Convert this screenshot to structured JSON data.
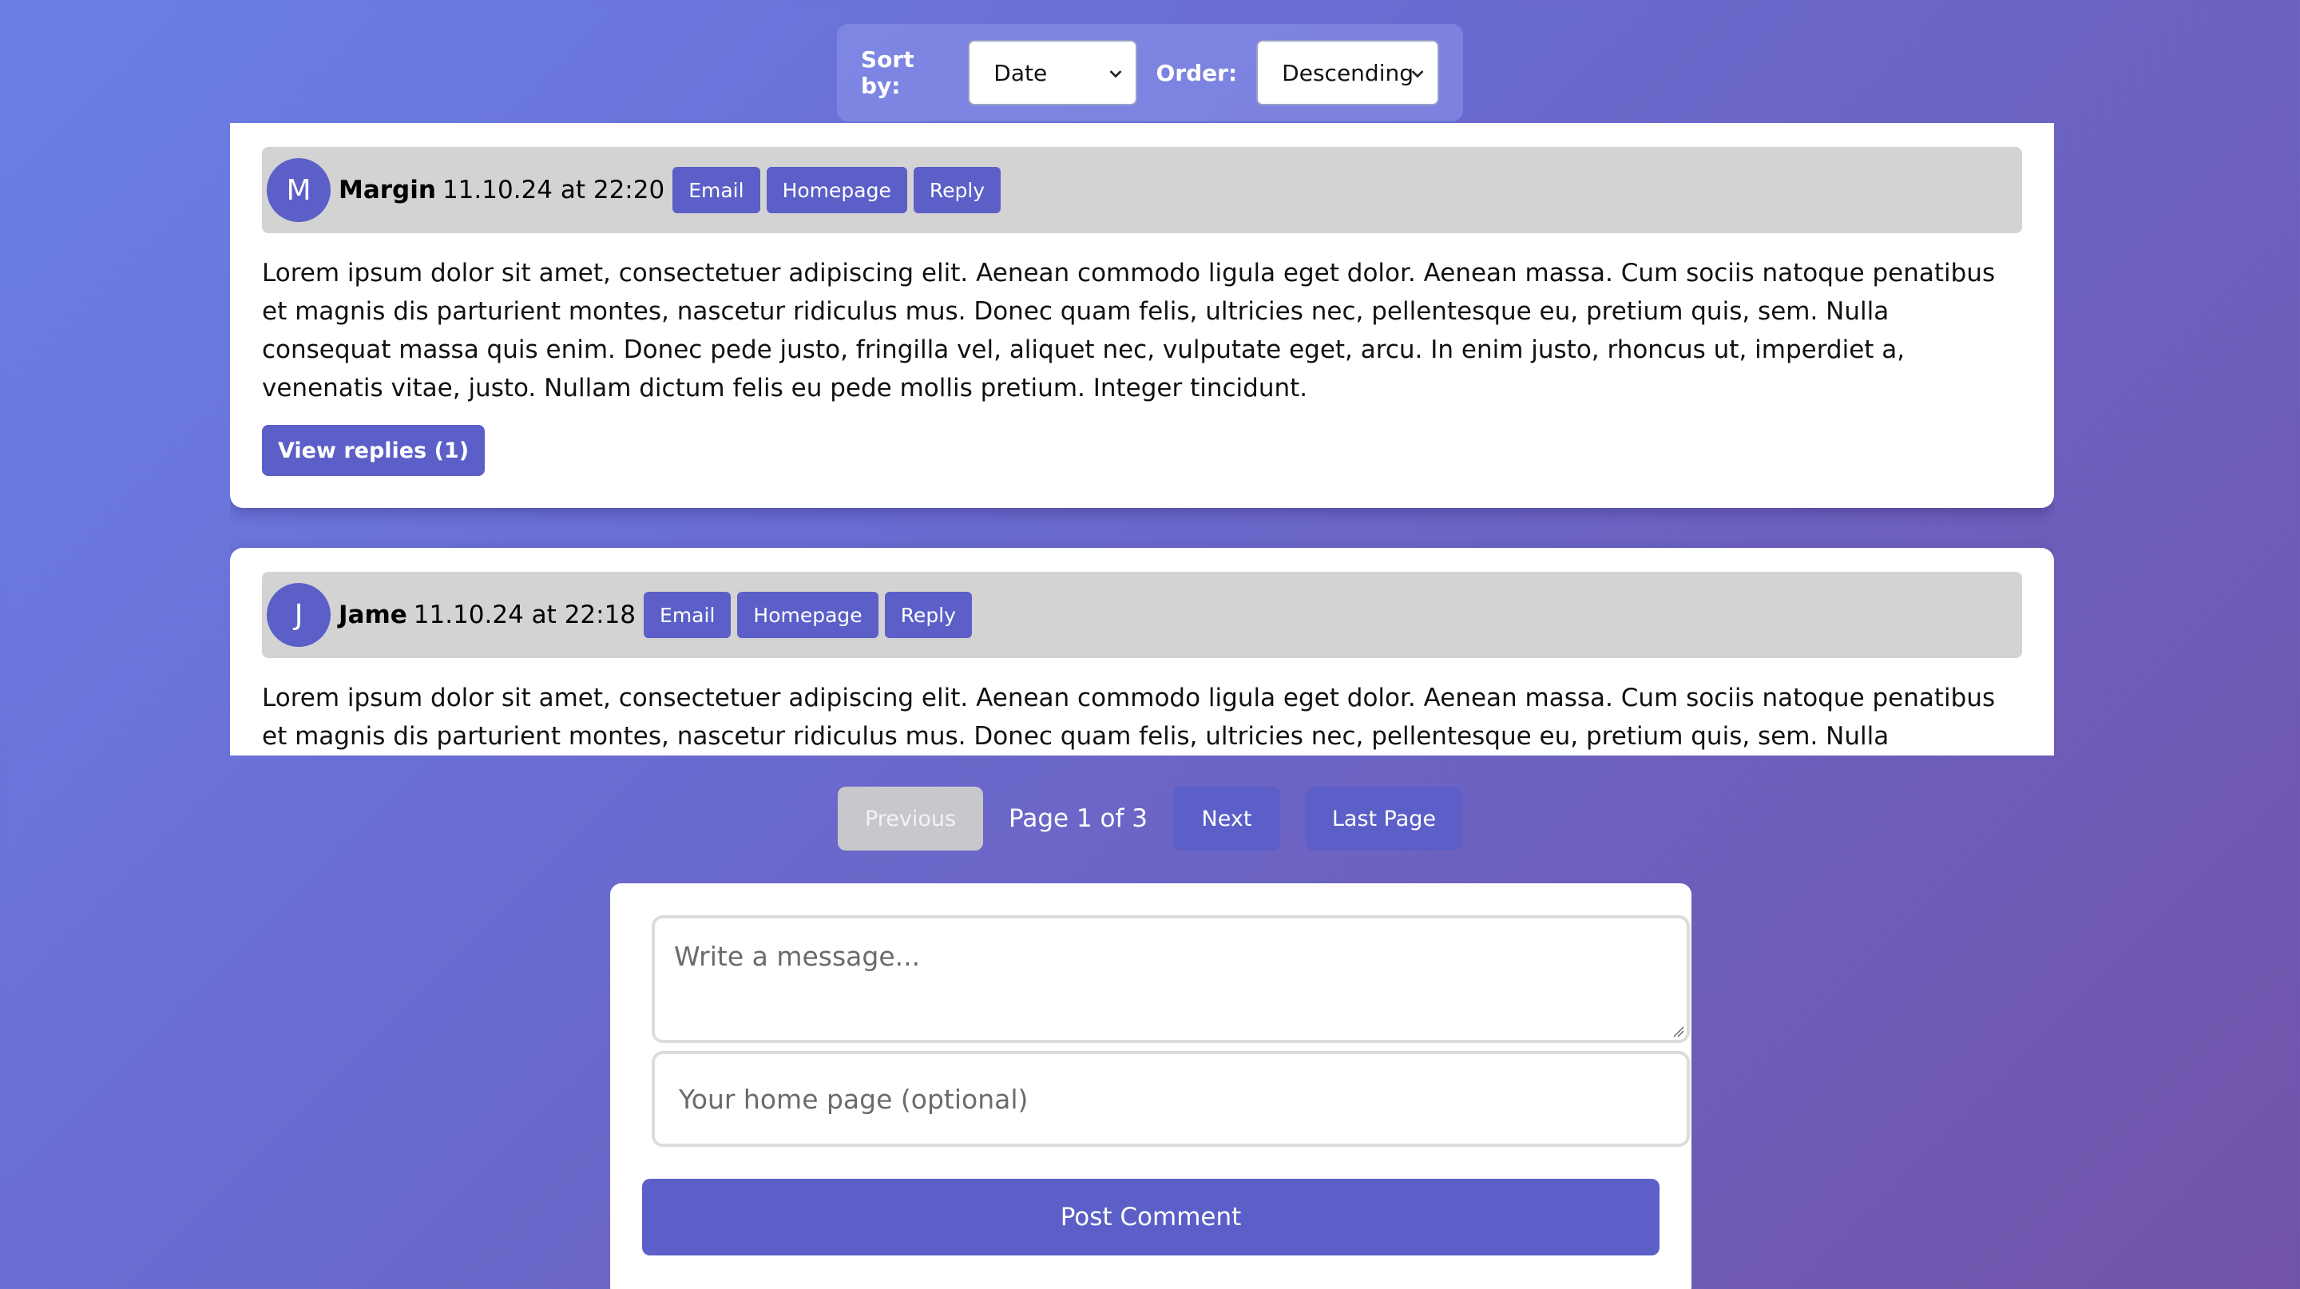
{
  "sort": {
    "sort_label": "Sort by:",
    "sort_value": "Date",
    "order_label": "Order:",
    "order_value": "Descending"
  },
  "comments": [
    {
      "initial": "M",
      "author": "Margin",
      "date": "11.10.24 at 22:20",
      "email_label": "Email",
      "homepage_label": "Homepage",
      "reply_label": "Reply",
      "text": "Lorem ipsum dolor sit amet, consectetuer adipiscing elit. Aenean commodo ligula eget dolor. Aenean massa. Cum sociis natoque penatibus et magnis dis parturient montes, nascetur ridiculus mus. Donec quam felis, ultricies nec, pellentesque eu, pretium quis, sem. Nulla consequat massa quis enim. Donec pede justo, fringilla vel, aliquet nec, vulputate eget, arcu. In enim justo, rhoncus ut, imperdiet a, venenatis vitae, justo. Nullam dictum felis eu pede mollis pretium. Integer tincidunt.",
      "view_replies_label": "View replies (1)"
    },
    {
      "initial": "J",
      "author": "Jame",
      "date": "11.10.24 at 22:18",
      "email_label": "Email",
      "homepage_label": "Homepage",
      "reply_label": "Reply",
      "text": "Lorem ipsum dolor sit amet, consectetuer adipiscing elit. Aenean commodo ligula eget dolor. Aenean massa. Cum sociis natoque penatibus et magnis dis parturient montes, nascetur ridiculus mus. Donec quam felis, ultricies nec, pellentesque eu, pretium quis, sem. Nulla consequat massa quis enim. Donec"
    }
  ],
  "pagination": {
    "previous_label": "Previous",
    "page_info": "Page 1 of 3",
    "next_label": "Next",
    "last_label": "Last Page"
  },
  "form": {
    "message_placeholder": "Write a message...",
    "homepage_placeholder": "Your home page (optional)",
    "submit_label": "Post Comment"
  },
  "colors": {
    "accent": "#5b5fc7",
    "header_bg": "#d3d3d3",
    "disabled": "#c8c8cc"
  }
}
